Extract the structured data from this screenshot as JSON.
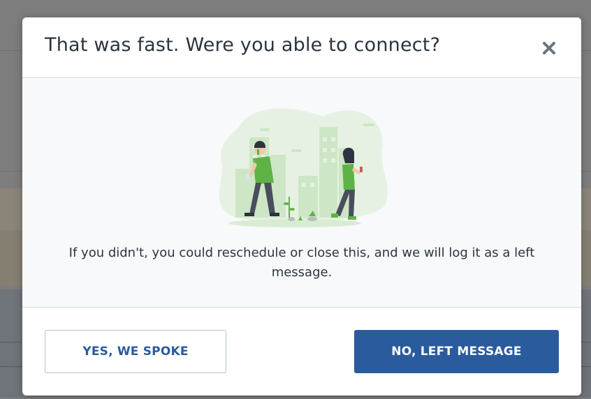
{
  "modal": {
    "title": "That was fast. Were you able to connect?",
    "close_icon": "close-icon",
    "message": "If you didn't, you could reschedule or close this, and we will log it as a left message.",
    "illustration": "people-walking-city-illustration"
  },
  "actions": {
    "yes_label": "YES, WE SPOKE",
    "no_label": "NO, LEFT MESSAGE"
  },
  "colors": {
    "primary": "#2a5b9c",
    "accent_green": "#5fb346",
    "overlay": "#7d7d7d"
  }
}
